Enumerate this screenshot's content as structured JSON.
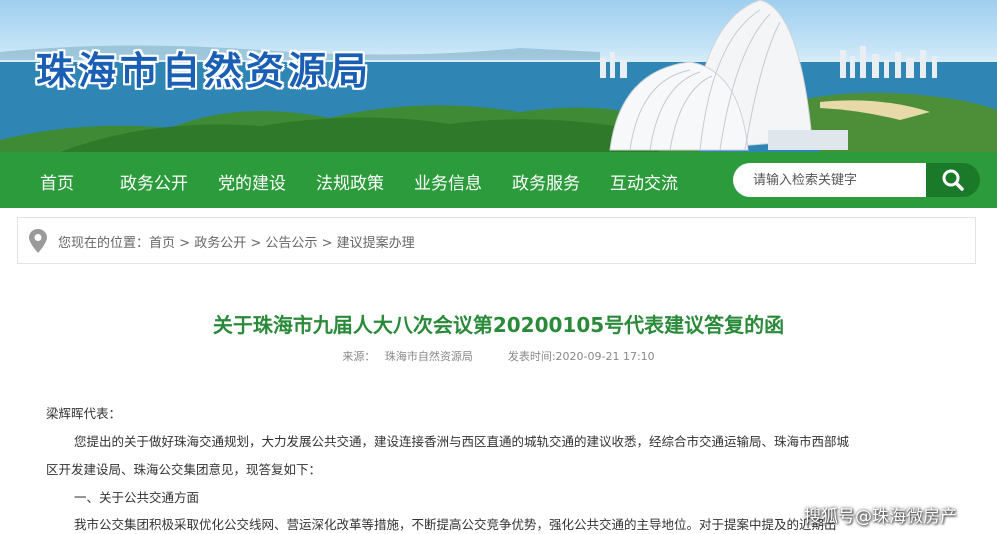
{
  "header": {
    "site_title": "珠海市自然资源局"
  },
  "nav": {
    "items": [
      "首页",
      "政务公开",
      "党的建设",
      "法规政策",
      "业务信息",
      "政务服务",
      "互动交流"
    ],
    "search_placeholder": "请输入检索关键字"
  },
  "breadcrumb": {
    "prefix": "您现在的位置：",
    "items": [
      "首页",
      "政务公开",
      "公告公示",
      "建议提案办理"
    ],
    "separator": ">"
  },
  "article": {
    "title": "关于珠海市九届人大八次会议第20200105号代表建议答复的函",
    "source_label": "来源：",
    "source_value": "珠海市自然资源局",
    "time_label": "发表时间:",
    "time_value": "2020-09-21 17:10",
    "paragraphs": [
      "梁辉晖代表：",
      "您提出的关于做好珠海交通规划，大力发展公共交通，建设连接香洲与西区直通的城轨交通的建议收悉，经综合市交通运输局、珠海市西部城",
      "区开发建设局、珠海公交集团意见，现答复如下：",
      "一、关于公共交通方面",
      "我市公交集团积极采取优化公交线网、营运深化改革等措施，不断提高公交竞争优势，强化公共交通的主导地位。对于提案中提及的近期出"
    ]
  },
  "watermark": "搜狐号@珠海微房产"
}
